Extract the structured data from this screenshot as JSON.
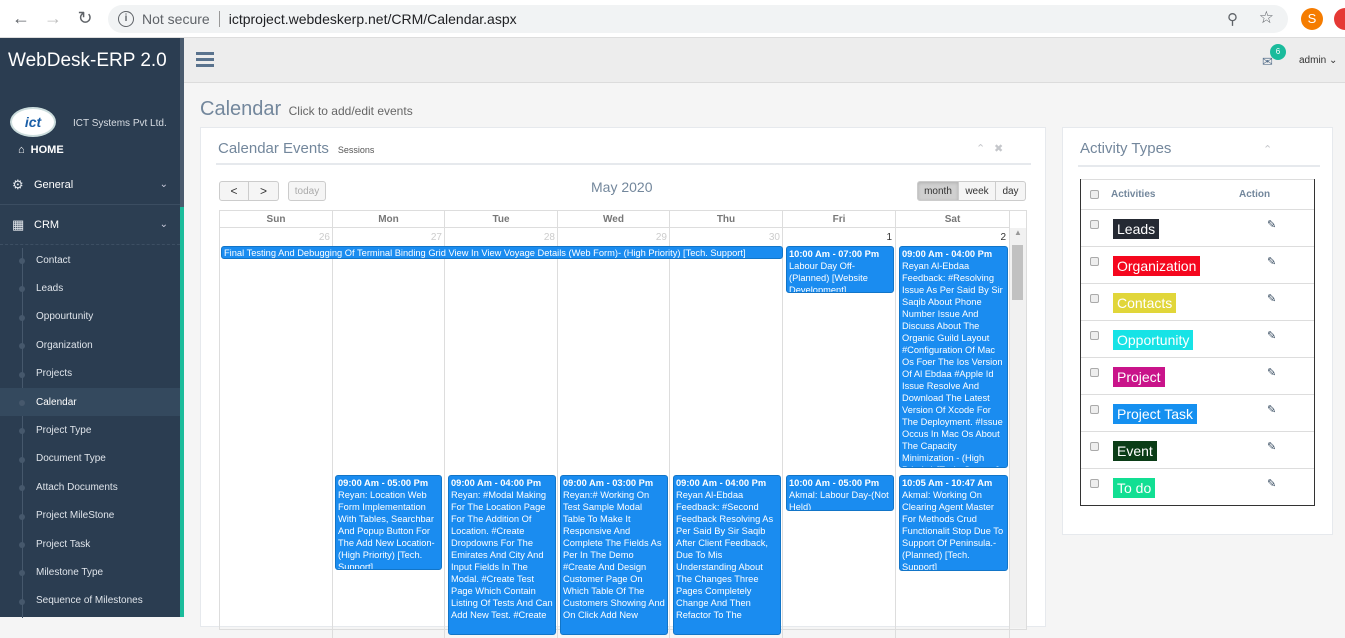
{
  "browser": {
    "url_prefix": "Not secure",
    "url": "ictproject.webdeskerp.net/CRM/Calendar.aspx",
    "profile_initial": "S"
  },
  "sidebar": {
    "brand": "WebDesk-ERP 2.0",
    "logo_text": "ict",
    "company": "ICT Systems Pvt Ltd.",
    "home": "HOME",
    "groups": [
      {
        "label": "General"
      },
      {
        "label": "CRM"
      }
    ],
    "items": [
      {
        "label": "Contact"
      },
      {
        "label": "Leads"
      },
      {
        "label": "Oppourtunity"
      },
      {
        "label": "Organization"
      },
      {
        "label": "Projects"
      },
      {
        "label": "Calendar",
        "active": true
      },
      {
        "label": "Project Type"
      },
      {
        "label": "Document Type"
      },
      {
        "label": "Attach Documents"
      },
      {
        "label": "Project MileStone"
      },
      {
        "label": "Project Task"
      },
      {
        "label": "Milestone Type"
      },
      {
        "label": "Sequence of Milestones"
      }
    ]
  },
  "topbar": {
    "mail_badge": "6",
    "user": "admin"
  },
  "page": {
    "title": "Calendar",
    "subtitle": "Click to add/edit events"
  },
  "calendar": {
    "panel_title": "Calendar Events",
    "panel_subtitle": "Sessions",
    "today_label": "today",
    "prev_label": "<",
    "next_label": ">",
    "month_title": "May 2020",
    "views": [
      "month",
      "week",
      "day"
    ],
    "active_view": "month",
    "weekdays": [
      "Sun",
      "Mon",
      "Tue",
      "Wed",
      "Thu",
      "Fri",
      "Sat"
    ],
    "week1_dates": [
      "26",
      "27",
      "28",
      "29",
      "30",
      "1",
      "2"
    ],
    "events": [
      {
        "text": "Final Testing And Debugging Of Terminal Binding Grid View In View Voyage Details (Web Form)- (High Priority) [Tech. Support]",
        "time": ""
      },
      {
        "time": "10:00 Am - 07:00 Pm",
        "text": "Labour Day Off-(Planned) [Website Development]"
      },
      {
        "time": "09:00 Am - 04:00 Pm",
        "text": "Reyan Al-Ebdaa Feedback: #Resolving Issue As Per Said By Sir Saqib About Phone Number Issue And Discuss About The Organic Guild Layout #Configuration Of Mac Os Foer The Ios Version Of Al Ebdaa #Apple Id Issue Resolve And Download The Latest Version Of Xcode For The Deployment. #Issue Occus In Mac Os About The Capacity Minimization - (High Priority) [Tech. Support]"
      },
      {
        "time": "09:00 Am - 05:00 Pm",
        "text": "Reyan: Location Web Form Implementation With Tables, Searchbar And Popup Button For The Add New Location-(High Priority) [Tech. Support]"
      },
      {
        "time": "09:00 Am - 04:00 Pm",
        "text": "Reyan: #Modal Making For The Location Page For The Addition Of Location. #Create Dropdowns For The Emirates And City And Input Fields In The Modal. #Create Test Page Which Contain Listing Of Tests And Can Add New Test. #Create"
      },
      {
        "time": "09:00 Am - 03:00 Pm",
        "text": "Reyan:# Working On Test Sample Modal Table To Make It Responsive And Complete The Fields As Per In The Demo #Create And Design Customer Page On Which Table Of The Customers Showing And On Click Add New"
      },
      {
        "time": "09:00 Am - 04:00 Pm",
        "text": "Reyan Al-Ebdaa Feedback: #Second Feedback Resolving As Per Said By Sir Saqib After Client Feedback, Due To Mis Understanding About The Changes Three Pages Completely Change And Then Refactor To The"
      },
      {
        "time": "10:00 Am - 05:00 Pm",
        "text": "Akmal: Labour Day-(Not Held)"
      },
      {
        "time": "10:05 Am - 10:47 Am",
        "text": "Akmal: Working On Clearing Agent Master For Methods Crud Functionalit Stop Due To Support Of Peninsula.-(Planned) [Tech. Support]"
      }
    ]
  },
  "activity": {
    "title": "Activity Types",
    "col_activities": "Activities",
    "col_action": "Action",
    "types": [
      {
        "label": "Leads",
        "color": "#252a33",
        "text_color": "#ffffff"
      },
      {
        "label": "Organization",
        "color": "#f5071e",
        "text_color": "#ffffff"
      },
      {
        "label": "Contacts",
        "color": "#e1d63a",
        "text_color": "#ffffff"
      },
      {
        "label": "Opportunity",
        "color": "#17e3e6",
        "text_color": "#ffffff"
      },
      {
        "label": "Project",
        "color": "#c9148a",
        "text_color": "#ffffff"
      },
      {
        "label": "Project Task",
        "color": "#1590f0",
        "text_color": "#ffffff"
      },
      {
        "label": "Event",
        "color": "#0b3d17",
        "text_color": "#ffffff"
      },
      {
        "label": "To do",
        "color": "#12df93",
        "text_color": "#ffffff"
      }
    ]
  }
}
